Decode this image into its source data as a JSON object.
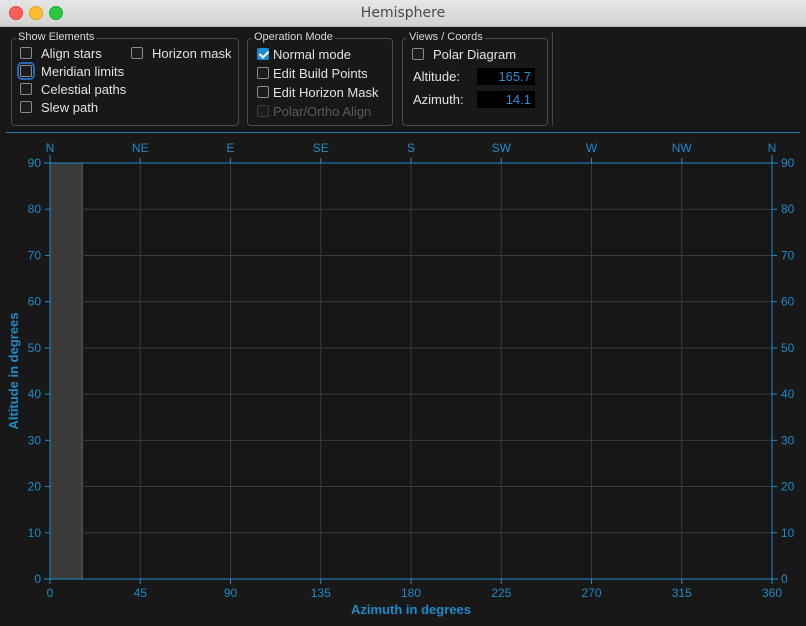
{
  "window": {
    "title": "Hemisphere"
  },
  "show_elements": {
    "title": "Show Elements",
    "items": [
      {
        "label": "Align stars",
        "checked": false
      },
      {
        "label": "Horizon mask",
        "checked": false
      },
      {
        "label": "Meridian limits",
        "checked": false,
        "focused": true
      },
      {
        "label": "Celestial paths",
        "checked": false
      },
      {
        "label": "Slew path",
        "checked": false
      }
    ]
  },
  "operation_mode": {
    "title": "Operation Mode",
    "items": [
      {
        "label": "Normal mode",
        "checked": true
      },
      {
        "label": "Edit Build Points",
        "checked": false
      },
      {
        "label": "Edit Horizon Mask",
        "checked": false
      },
      {
        "label": "Polar/Ortho Align",
        "checked": false,
        "disabled": true
      }
    ]
  },
  "views_coords": {
    "title": "Views / Coords",
    "polar_label": "Polar Diagram",
    "polar_checked": false,
    "altitude_label": "Altitude:",
    "altitude_value": "165.7",
    "azimuth_label": "Azimuth:",
    "azimuth_value": "14.1"
  },
  "chart_data": {
    "type": "scatter",
    "title": "",
    "xlabel": "Azimuth in degrees",
    "ylabel": "Altitude in degrees",
    "xlim": [
      0,
      360
    ],
    "ylim": [
      0,
      90
    ],
    "x_ticks": [
      0,
      45,
      90,
      135,
      180,
      225,
      270,
      315,
      360
    ],
    "y_ticks": [
      0,
      10,
      20,
      30,
      40,
      50,
      60,
      70,
      80,
      90
    ],
    "top_labels": [
      "N",
      "NE",
      "E",
      "SE",
      "S",
      "SW",
      "W",
      "NW",
      "N"
    ],
    "grid": true,
    "shaded_band_azimuth": [
      0,
      16
    ],
    "series": [],
    "colors": {
      "axis": "#1f8ac8",
      "grid": "#3a3a3a",
      "band": "#3a3a3a",
      "background": "#161616"
    }
  }
}
